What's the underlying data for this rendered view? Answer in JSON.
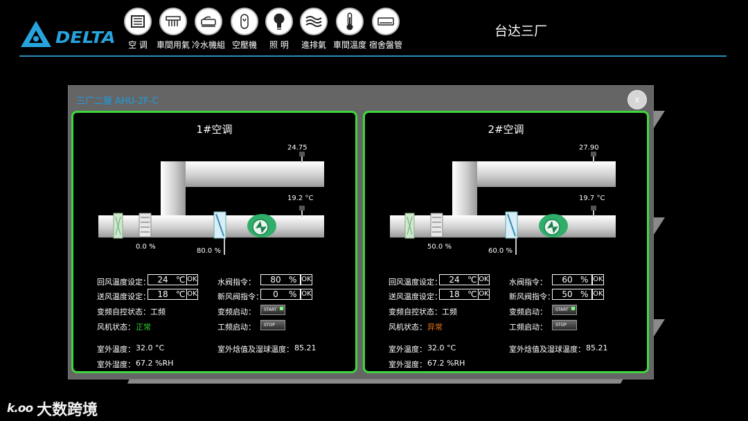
{
  "brand": {
    "name": "DELTA",
    "accent": "#27a3dd"
  },
  "site_title": "台达三厂",
  "nav": [
    {
      "label": "空 调",
      "icon": "ac-unit-icon"
    },
    {
      "label": "車間用氣",
      "icon": "air-supply-icon"
    },
    {
      "label": "冷水機組",
      "icon": "chiller-icon"
    },
    {
      "label": "空壓機",
      "icon": "air-compressor-icon"
    },
    {
      "label": "照 明",
      "icon": "light-bulb-icon"
    },
    {
      "label": "進排氣",
      "icon": "ventilation-icon"
    },
    {
      "label": "車間溫度",
      "icon": "thermometer-icon"
    },
    {
      "label": "宿舍盤管",
      "icon": "coil-icon"
    }
  ],
  "modal": {
    "title": "三厂二層 AHU-2F-C",
    "close_label": "x"
  },
  "labels": {
    "return_temp_set": "回风温度设定：",
    "supply_temp_set": "送风温度设定：",
    "vfd_mode": "变频自控状态：工频",
    "fan_status": "风机状态：",
    "water_valve_cmd": "水阀指令：",
    "fresh_valve_cmd": "新风阀指令：",
    "vfd_start": "变频启动：",
    "line_start": "工频启动：",
    "outdoor_temp": "室外温度：",
    "outdoor_enthalpy": "室外焓值及湿球温度：",
    "outdoor_humidity": "室外湿度："
  },
  "units": {
    "temp": "℃",
    "pct": "%",
    "ok": "OK",
    "start": "START",
    "stop": "STOP"
  },
  "panels": [
    {
      "title": "1#空调",
      "return_air_reading": "24.75",
      "supply_air_reading": "19.2 °C",
      "fresh_damper_pct": "0.0 %",
      "water_valve_pct": "80.0 %",
      "return_temp_set": "24",
      "supply_temp_set": "18",
      "water_valve_cmd": "80",
      "fresh_valve_cmd": "0",
      "fan_status": "正常",
      "fan_status_color": "#2ecc2e",
      "outdoor_temp": "32.0 °C",
      "outdoor_humidity": "67.2 %RH",
      "outdoor_enthalpy": "85.21"
    },
    {
      "title": "2#空调",
      "return_air_reading": "27.90",
      "supply_air_reading": "19.7 °C",
      "fresh_damper_pct": "50.0 %",
      "water_valve_pct": "60.0 %",
      "return_temp_set": "24",
      "supply_temp_set": "18",
      "water_valve_cmd": "60",
      "fresh_valve_cmd": "50",
      "fan_status": "异常",
      "fan_status_color": "#e8731a",
      "outdoor_temp": "32.0 °C",
      "outdoor_humidity": "67.2 %RH",
      "outdoor_enthalpy": "85.21"
    }
  ],
  "watermark": {
    "logo": "k.oo",
    "text": "大数跨境"
  }
}
